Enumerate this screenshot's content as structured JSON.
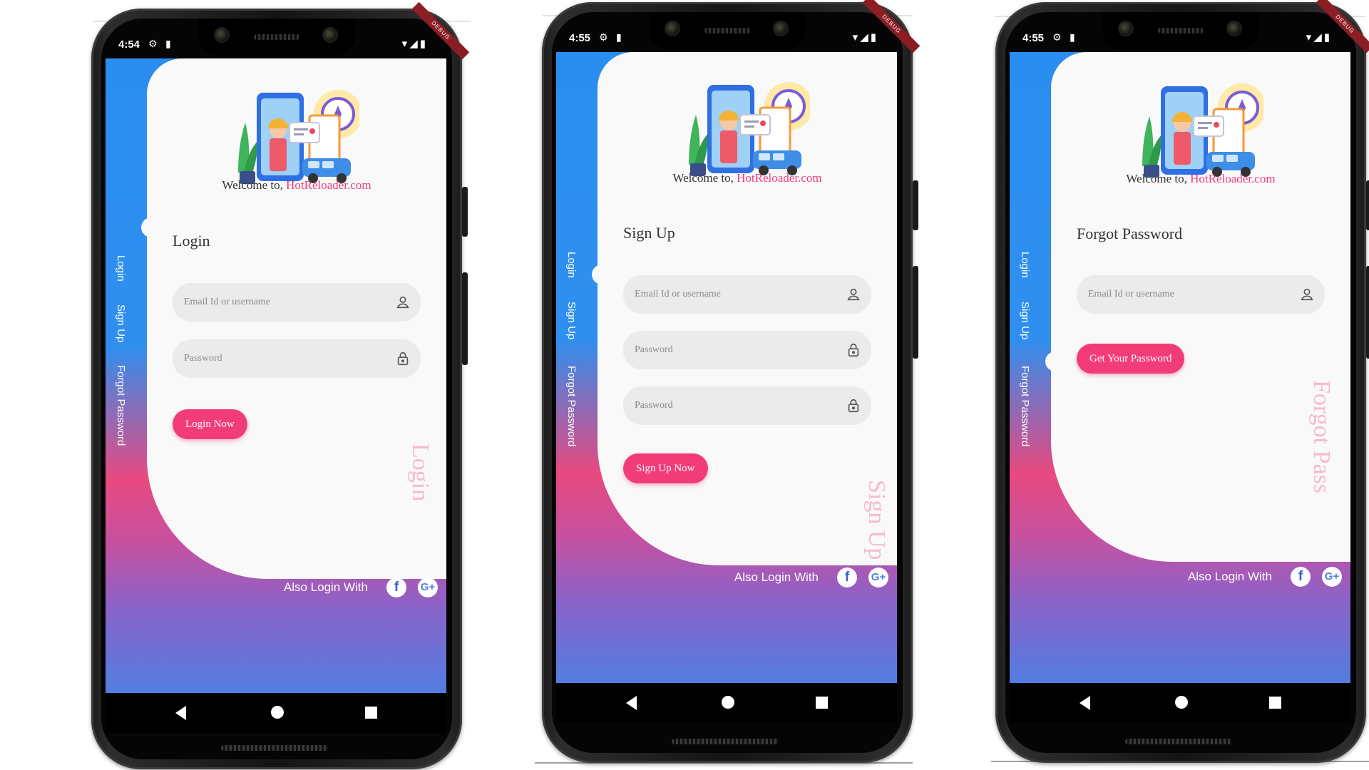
{
  "phones": [
    {
      "status_time": "4:54",
      "welcome_prefix": "Welcome to, ",
      "welcome_brand": "HotReloader.com",
      "tabs": [
        "Login",
        "Sign Up",
        "Forgot Password"
      ],
      "active_tab": "Login",
      "form_title": "Login",
      "fields": [
        {
          "placeholder": "Email Id or username",
          "icon": "user-icon"
        },
        {
          "placeholder": "Password",
          "icon": "lock-icon"
        }
      ],
      "button_label": "Login Now",
      "watermark": "Login",
      "also_login": "Also Login With"
    },
    {
      "status_time": "4:55",
      "welcome_prefix": "Welcome to, ",
      "welcome_brand": "HotReloader.com",
      "tabs": [
        "Login",
        "Sign Up",
        "Forgot Password"
      ],
      "active_tab": "Sign Up",
      "form_title": "Sign Up",
      "fields": [
        {
          "placeholder": "Email Id or username",
          "icon": "user-icon"
        },
        {
          "placeholder": "Password",
          "icon": "lock-icon"
        },
        {
          "placeholder": "Password",
          "icon": "lock-icon"
        }
      ],
      "button_label": "Sign Up Now",
      "watermark": "Sign Up",
      "also_login": "Also Login With"
    },
    {
      "status_time": "4:55",
      "welcome_prefix": "Welcome to, ",
      "welcome_brand": "HotReloader.com",
      "tabs": [
        "Login",
        "Sign Up",
        "Forgot Password"
      ],
      "active_tab": "Forgot Password",
      "form_title": "Forgot Password",
      "fields": [
        {
          "placeholder": "Email Id or username",
          "icon": "user-icon"
        }
      ],
      "button_label": "Get Your Password",
      "watermark": "Forgot Pass",
      "also_login": "Also Login With"
    }
  ],
  "colors": {
    "accent": "#f23c78",
    "brand_link": "#ef3e7a",
    "gradient_top": "#2a8ef0",
    "gradient_mid": "#e8497f",
    "gradient_bottom": "#4f7fe3"
  },
  "debug_banner": "DEBUG"
}
